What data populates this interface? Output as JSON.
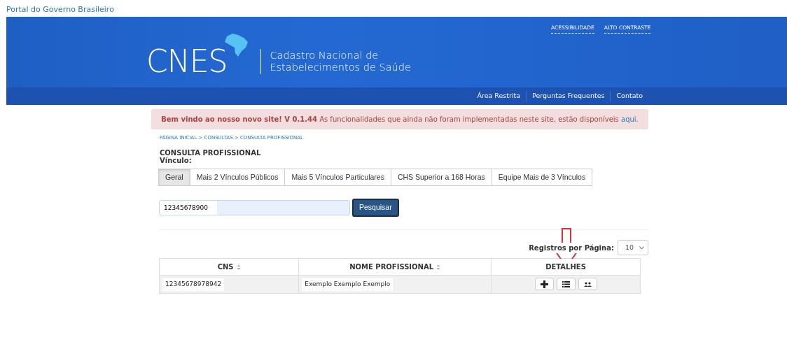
{
  "gov_link": "Portal do Governo Brasileiro",
  "header": {
    "logo_text": "CNES",
    "title_line_1": "Cadastro Nacional de",
    "title_line_2": "Estabelecimentos de Saúde",
    "top_links": [
      "ACESSIBILIDADE",
      "ALTO CONTRASTE"
    ]
  },
  "nav": [
    "Área Restrita",
    "Perguntas Frequentes",
    "Contato"
  ],
  "alert": {
    "text": "**Bem vindo ao nosso novo site! V 0.1.44** As funcionalidades que ainda não foram implementadas neste site, estão disponíveis",
    "link": "aqui."
  },
  "breadcrumb": "PÁGINA INICIAL > CONSULTAS > CONSULTA PROFISSIONAL",
  "page_title": "CONSULTA PROFISSIONAL",
  "vinculo_label": "Vínculo:",
  "tabs": [
    {
      "label": "Geral",
      "selected": true
    },
    {
      "label": "Mais 2 Vínculos Públicos",
      "selected": false
    },
    {
      "label": "Mais 5 Vínculos Particulares",
      "selected": false
    },
    {
      "label": "CHS Superior a 168 Horas",
      "selected": false
    },
    {
      "label": "Equipe Mais de 3 Vínculos",
      "selected": false
    }
  ],
  "search": {
    "value": "12345678900",
    "button": "Pesquisar"
  },
  "page_size": {
    "label": "Registros por Página:",
    "value": "10"
  },
  "table": {
    "columns": [
      {
        "label": "CNS",
        "sortable": true
      },
      {
        "label": "NOME PROFISSIONAL",
        "sortable": true
      },
      {
        "label": "DETALHES",
        "sortable": false
      }
    ],
    "rows": [
      {
        "cns": "12345678978942",
        "nome": "Exemplo Exemplo Exemplo",
        "actions": [
          {
            "kind": "plus"
          },
          {
            "kind": "list"
          },
          {
            "kind": "people"
          }
        ]
      }
    ]
  }
}
